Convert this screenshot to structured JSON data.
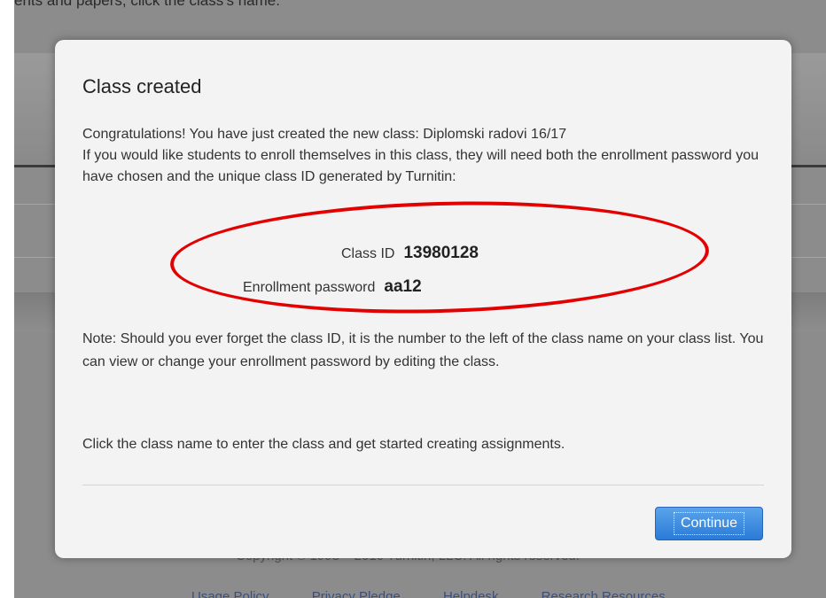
{
  "background_page": {
    "top_text": "ents and papers, click the class's name.",
    "footer_copyright": "Copyright © 1998 – 2016 Turnitin, LLC. All rights reserved.",
    "footer_links": [
      "Usage Policy",
      "Privacy Pledge",
      "Helpdesk",
      "Research Resources"
    ]
  },
  "modal": {
    "title": "Class created",
    "intro_line1": "Congratulations! You have just created the new class: Diplomski radovi 16/17",
    "intro_line2": "If you would like students to enroll themselves in this class, they will need both the enrollment password you have chosen and the unique class ID generated by Turnitin:",
    "class_id_label": "Class ID",
    "class_id_value": "13980128",
    "password_label": "Enrollment password",
    "password_value": "aa12",
    "note": "Note: Should you ever forget the class ID, it is the number to the left of the class name on your class list. You can view or change your enrollment password by editing the class.",
    "instruction": "Click the class name to enter the class and get started creating assignments.",
    "continue_label": "Continue"
  },
  "colors": {
    "highlight_oval": "#e30000",
    "button": "#2a7ad8"
  }
}
